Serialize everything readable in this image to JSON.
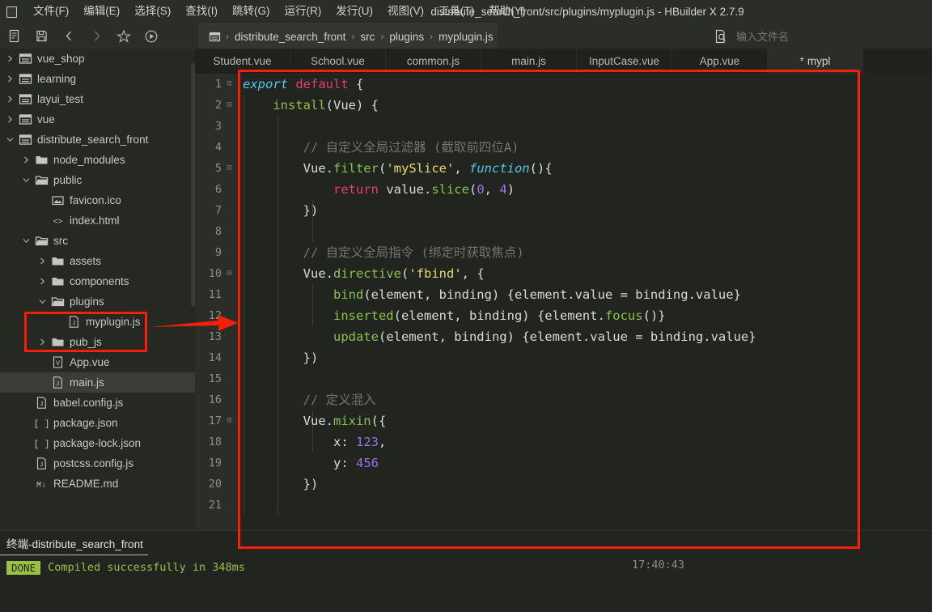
{
  "window": {
    "title": "distribute_search_front/src/plugins/myplugin.js - HBuilder X 2.7.9"
  },
  "menubar": {
    "items": [
      {
        "label": "文件(F)",
        "name": "menu-file"
      },
      {
        "label": "编辑(E)",
        "name": "menu-edit"
      },
      {
        "label": "选择(S)",
        "name": "menu-select"
      },
      {
        "label": "查找(I)",
        "name": "menu-find"
      },
      {
        "label": "跳转(G)",
        "name": "menu-goto"
      },
      {
        "label": "运行(R)",
        "name": "menu-run"
      },
      {
        "label": "发行(U)",
        "name": "menu-publish"
      },
      {
        "label": "视图(V)",
        "name": "menu-view"
      },
      {
        "label": "工具(T)",
        "name": "menu-tools"
      },
      {
        "label": "帮助(Y)",
        "name": "menu-help"
      }
    ]
  },
  "toolbar": {
    "buttons": [
      {
        "name": "new-file-icon"
      },
      {
        "name": "save-icon"
      },
      {
        "name": "back-arrow-icon"
      },
      {
        "name": "forward-arrow-icon"
      },
      {
        "name": "star-icon"
      },
      {
        "name": "run-icon"
      }
    ]
  },
  "breadcrumb": {
    "root_icon": "folder-icon",
    "items": [
      "distribute_search_front",
      "src",
      "plugins",
      "myplugin.js"
    ],
    "separator": "›"
  },
  "filename_search": {
    "icon": "file-search-icon",
    "placeholder": "输入文件名",
    "value": ""
  },
  "sidebar": {
    "items": [
      {
        "label": "vue_shop",
        "indent": 0,
        "twisty": "right",
        "icon": "folder-open-box-icon",
        "selected": false
      },
      {
        "label": "learning",
        "indent": 0,
        "twisty": "right",
        "icon": "folder-open-box-icon",
        "selected": false
      },
      {
        "label": "layui_test",
        "indent": 0,
        "twisty": "right",
        "icon": "folder-open-box-icon",
        "selected": false
      },
      {
        "label": "vue",
        "indent": 0,
        "twisty": "right",
        "icon": "folder-open-box-icon",
        "selected": false
      },
      {
        "label": "distribute_search_front",
        "indent": 0,
        "twisty": "down",
        "icon": "folder-open-box-icon",
        "selected": false
      },
      {
        "label": "node_modules",
        "indent": 1,
        "twisty": "right",
        "icon": "folder-icon",
        "selected": false
      },
      {
        "label": "public",
        "indent": 1,
        "twisty": "down",
        "icon": "folder-open-icon",
        "selected": false
      },
      {
        "label": "favicon.ico",
        "indent": 2,
        "twisty": "none",
        "icon": "image-file-icon",
        "selected": false
      },
      {
        "label": "index.html",
        "indent": 2,
        "twisty": "none",
        "icon": "html-file-icon",
        "selected": false
      },
      {
        "label": "src",
        "indent": 1,
        "twisty": "down",
        "icon": "folder-open-icon",
        "selected": false
      },
      {
        "label": "assets",
        "indent": 2,
        "twisty": "right",
        "icon": "folder-icon",
        "selected": false
      },
      {
        "label": "components",
        "indent": 2,
        "twisty": "right",
        "icon": "folder-icon",
        "selected": false
      },
      {
        "label": "plugins",
        "indent": 2,
        "twisty": "down",
        "icon": "folder-open-icon",
        "selected": false
      },
      {
        "label": "myplugin.js",
        "indent": 3,
        "twisty": "none",
        "icon": "js-file-icon",
        "selected": false
      },
      {
        "label": "pub_js",
        "indent": 2,
        "twisty": "right",
        "icon": "folder-icon",
        "selected": false
      },
      {
        "label": "App.vue",
        "indent": 2,
        "twisty": "none",
        "icon": "vue-file-icon",
        "selected": false
      },
      {
        "label": "main.js",
        "indent": 2,
        "twisty": "none",
        "icon": "js-file-icon",
        "selected": true
      },
      {
        "label": "babel.config.js",
        "indent": 1,
        "twisty": "none",
        "icon": "js-file-icon",
        "selected": false
      },
      {
        "label": "package.json",
        "indent": 1,
        "twisty": "none",
        "icon": "json-file-icon",
        "selected": false
      },
      {
        "label": "package-lock.json",
        "indent": 1,
        "twisty": "none",
        "icon": "json-file-icon",
        "selected": false
      },
      {
        "label": "postcss.config.js",
        "indent": 1,
        "twisty": "none",
        "icon": "js-file-icon",
        "selected": false
      },
      {
        "label": "README.md",
        "indent": 1,
        "twisty": "none",
        "icon": "md-file-icon",
        "selected": false
      }
    ]
  },
  "editor": {
    "tabs": [
      {
        "label": "Student.vue",
        "modified": false,
        "active": false
      },
      {
        "label": "School.vue",
        "modified": false,
        "active": false
      },
      {
        "label": "common.js",
        "modified": false,
        "active": false
      },
      {
        "label": "main.js",
        "modified": false,
        "active": false
      },
      {
        "label": "InputCase.vue",
        "modified": false,
        "active": false
      },
      {
        "label": "App.vue",
        "modified": false,
        "active": false
      },
      {
        "label": "mypl",
        "modified": true,
        "active": true,
        "modified_marker": "*"
      }
    ],
    "line_numbers": [
      "1",
      "2",
      "3",
      "4",
      "5",
      "6",
      "7",
      "8",
      "9",
      "10",
      "11",
      "12",
      "13",
      "14",
      "15",
      "16",
      "17",
      "18",
      "19",
      "20",
      "21"
    ],
    "fold_lines": [
      1,
      2,
      5,
      10,
      17
    ],
    "fold_glyph": "⊟",
    "lines": [
      {
        "n": 1,
        "tokens": [
          {
            "t": "export ",
            "c": "t-kw"
          },
          {
            "t": "default",
            "c": "t-kw2"
          },
          {
            "t": " {",
            "c": "t-plain"
          }
        ]
      },
      {
        "n": 2,
        "tokens": [
          {
            "t": "    ",
            "c": "t-plain"
          },
          {
            "t": "install",
            "c": "t-fn"
          },
          {
            "t": "(Vue) {",
            "c": "t-plain"
          }
        ]
      },
      {
        "n": 3,
        "tokens": []
      },
      {
        "n": 4,
        "tokens": [
          {
            "t": "        // 自定义全局过滤器 (截取前四位A)",
            "c": "t-cmt"
          }
        ]
      },
      {
        "n": 5,
        "tokens": [
          {
            "t": "        Vue.",
            "c": "t-plain"
          },
          {
            "t": "filter",
            "c": "t-fn"
          },
          {
            "t": "(",
            "c": "t-plain"
          },
          {
            "t": "'mySlice'",
            "c": "t-str"
          },
          {
            "t": ", ",
            "c": "t-plain"
          },
          {
            "t": "function",
            "c": "t-func-it"
          },
          {
            "t": "(){",
            "c": "t-plain"
          }
        ]
      },
      {
        "n": 6,
        "tokens": [
          {
            "t": "            ",
            "c": "t-plain"
          },
          {
            "t": "return",
            "c": "t-ret"
          },
          {
            "t": " value.",
            "c": "t-plain"
          },
          {
            "t": "slice",
            "c": "t-fn"
          },
          {
            "t": "(",
            "c": "t-plain"
          },
          {
            "t": "0",
            "c": "t-num"
          },
          {
            "t": ", ",
            "c": "t-plain"
          },
          {
            "t": "4",
            "c": "t-num"
          },
          {
            "t": ")",
            "c": "t-plain"
          }
        ]
      },
      {
        "n": 7,
        "tokens": [
          {
            "t": "        })",
            "c": "t-plain"
          }
        ]
      },
      {
        "n": 8,
        "tokens": []
      },
      {
        "n": 9,
        "tokens": [
          {
            "t": "        // 自定义全局指令 (绑定时获取焦点)",
            "c": "t-cmt"
          }
        ]
      },
      {
        "n": 10,
        "tokens": [
          {
            "t": "        Vue.",
            "c": "t-plain"
          },
          {
            "t": "directive",
            "c": "t-fn"
          },
          {
            "t": "(",
            "c": "t-plain"
          },
          {
            "t": "'fbind'",
            "c": "t-str"
          },
          {
            "t": ", {",
            "c": "t-plain"
          }
        ]
      },
      {
        "n": 11,
        "tokens": [
          {
            "t": "            ",
            "c": "t-plain"
          },
          {
            "t": "bind",
            "c": "t-fn"
          },
          {
            "t": "(element, binding) {element.value = binding.value}",
            "c": "t-plain"
          }
        ]
      },
      {
        "n": 12,
        "tokens": [
          {
            "t": "            ",
            "c": "t-plain"
          },
          {
            "t": "inserted",
            "c": "t-fn"
          },
          {
            "t": "(element, binding) {element.",
            "c": "t-plain"
          },
          {
            "t": "focus",
            "c": "t-fn"
          },
          {
            "t": "()}",
            "c": "t-plain"
          }
        ]
      },
      {
        "n": 13,
        "tokens": [
          {
            "t": "            ",
            "c": "t-plain"
          },
          {
            "t": "update",
            "c": "t-fn"
          },
          {
            "t": "(element, binding) {element.value = binding.value}",
            "c": "t-plain"
          }
        ]
      },
      {
        "n": 14,
        "tokens": [
          {
            "t": "        })",
            "c": "t-plain"
          }
        ]
      },
      {
        "n": 15,
        "tokens": []
      },
      {
        "n": 16,
        "tokens": [
          {
            "t": "        // 定义混入",
            "c": "t-cmt"
          }
        ]
      },
      {
        "n": 17,
        "tokens": [
          {
            "t": "        Vue.",
            "c": "t-plain"
          },
          {
            "t": "mixin",
            "c": "t-fn"
          },
          {
            "t": "({",
            "c": "t-plain"
          }
        ]
      },
      {
        "n": 18,
        "tokens": [
          {
            "t": "            x: ",
            "c": "t-plain"
          },
          {
            "t": "123",
            "c": "t-num"
          },
          {
            "t": ",",
            "c": "t-plain"
          }
        ]
      },
      {
        "n": 19,
        "tokens": [
          {
            "t": "            y: ",
            "c": "t-plain"
          },
          {
            "t": "456",
            "c": "t-num"
          }
        ]
      },
      {
        "n": 20,
        "tokens": [
          {
            "t": "        })",
            "c": "t-plain"
          }
        ]
      },
      {
        "n": 21,
        "tokens": []
      }
    ]
  },
  "console": {
    "tab_label": "终端-distribute_search_front",
    "badge": "DONE",
    "message": "Compiled successfully in 348ms",
    "timestamp": "17:40:43"
  },
  "annotations": {
    "editor_box_color": "#fa1e09",
    "tree_box_color": "#fa1e09",
    "arrow_color": "#fa1e09",
    "arrow_target_line": "12"
  }
}
